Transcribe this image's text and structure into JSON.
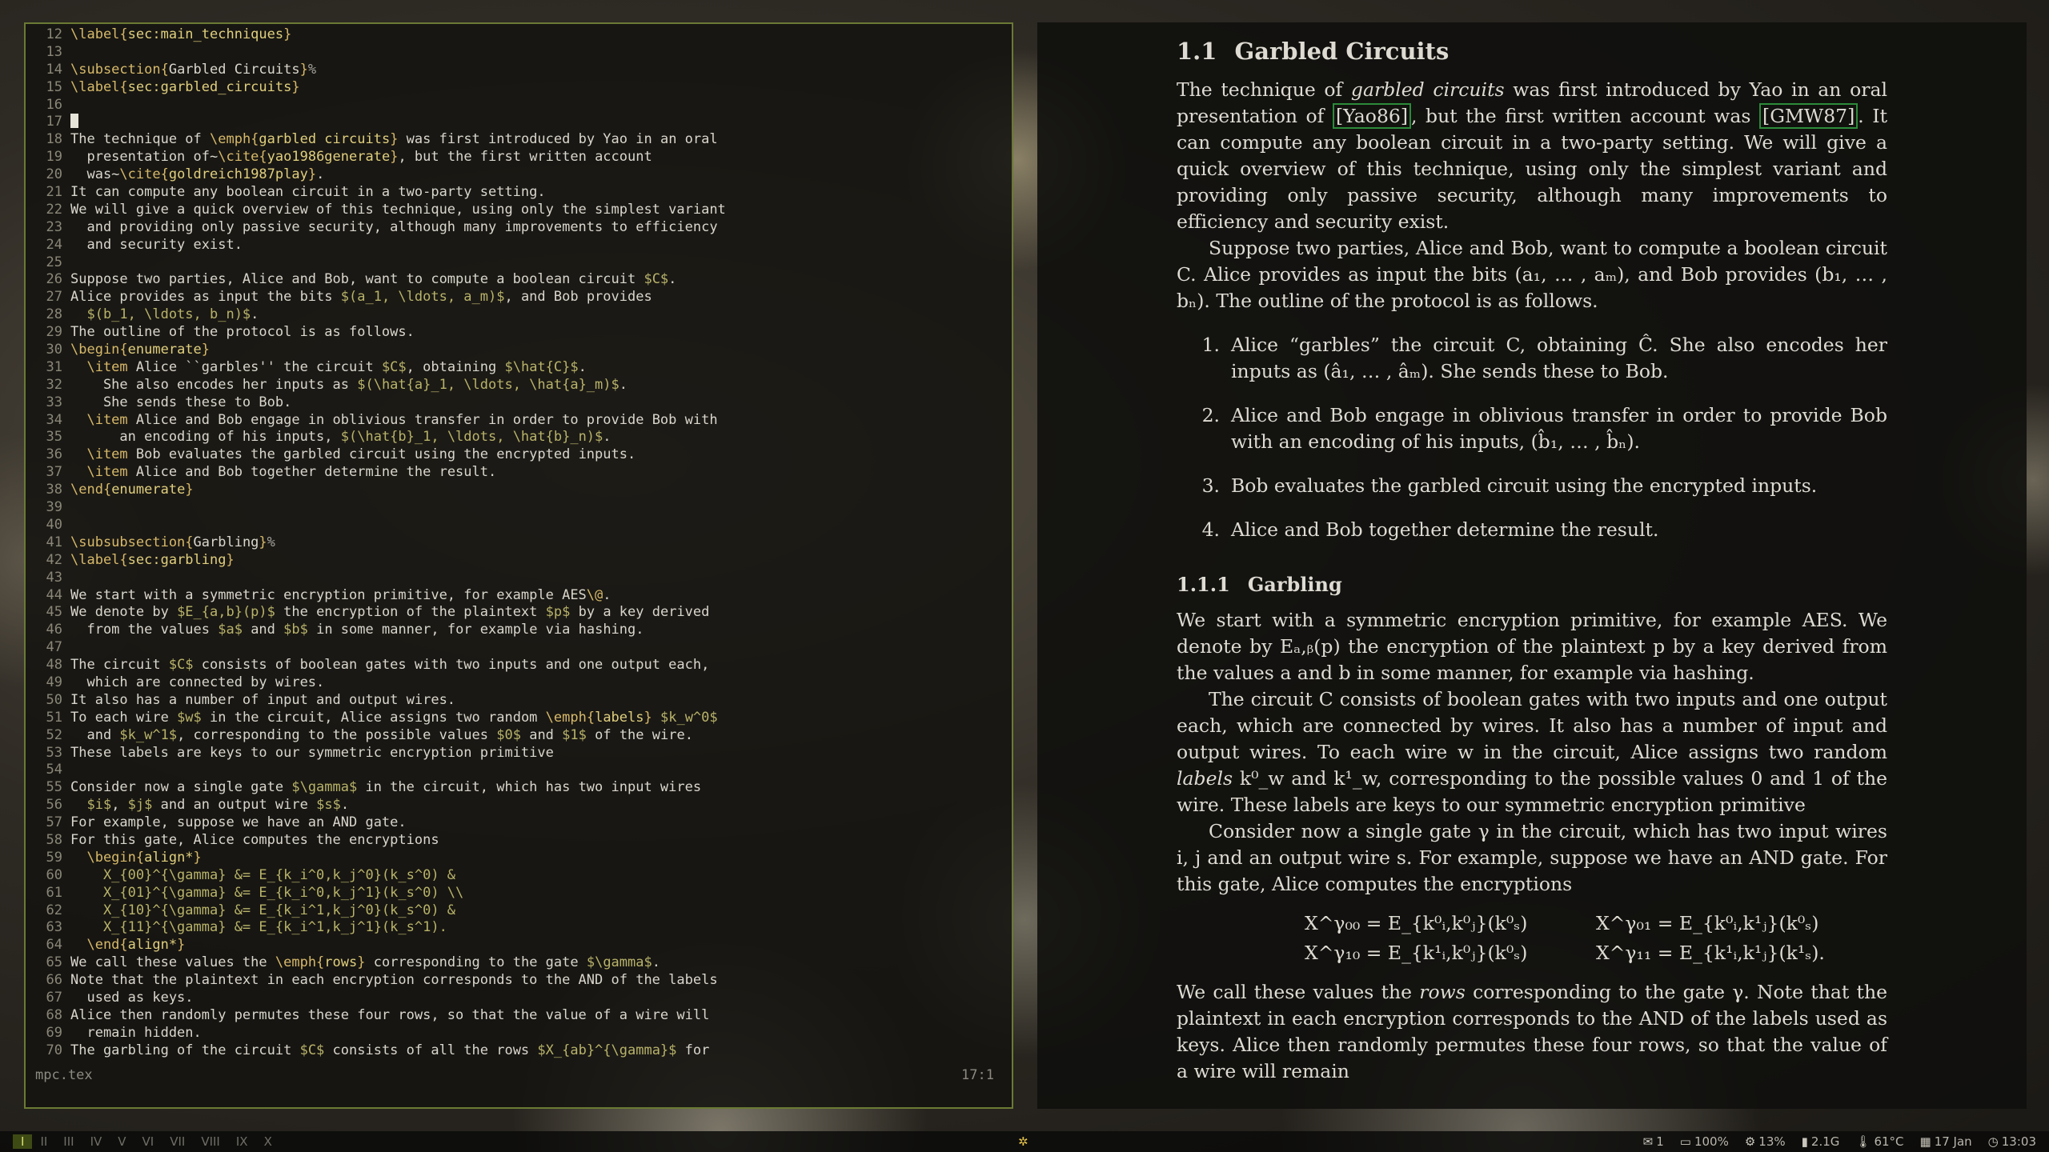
{
  "editor": {
    "filename": "mpc.tex",
    "position": "17:1",
    "lines": [
      {
        "n": "12",
        "segs": [
          [
            "kw",
            "\\label{"
          ],
          [
            "arg",
            "sec:main_techniques"
          ],
          [
            "kw",
            "}"
          ]
        ]
      },
      {
        "n": "13",
        "segs": []
      },
      {
        "n": "14",
        "segs": [
          [
            "kw",
            "\\subsection{"
          ],
          [
            "",
            "Garbled Circuits"
          ],
          [
            "kw",
            "}"
          ],
          [
            "mt",
            "%"
          ]
        ]
      },
      {
        "n": "15",
        "segs": [
          [
            "kw",
            "\\label{"
          ],
          [
            "arg",
            "sec:garbled_circuits"
          ],
          [
            "kw",
            "}"
          ]
        ]
      },
      {
        "n": "16",
        "segs": []
      },
      {
        "n": "17",
        "cursor": true,
        "segs": []
      },
      {
        "n": "18",
        "segs": [
          [
            "",
            "The technique of "
          ],
          [
            "kw",
            "\\emph{"
          ],
          [
            "arg",
            "garbled circuits"
          ],
          [
            "kw",
            "}"
          ],
          [
            "",
            " was first introduced by Yao in an oral"
          ]
        ]
      },
      {
        "n": "19",
        "segs": [
          [
            "",
            "  presentation of~"
          ],
          [
            "kw",
            "\\cite{"
          ],
          [
            "arg",
            "yao1986generate"
          ],
          [
            "kw",
            "}"
          ],
          [
            "",
            ", but the first written account"
          ]
        ]
      },
      {
        "n": "20",
        "segs": [
          [
            "",
            "  was~"
          ],
          [
            "kw",
            "\\cite{"
          ],
          [
            "arg",
            "goldreich1987play"
          ],
          [
            "kw",
            "}"
          ],
          [
            "",
            "."
          ]
        ]
      },
      {
        "n": "21",
        "segs": [
          [
            "",
            "It can compute any boolean circuit in a two-party setting."
          ]
        ]
      },
      {
        "n": "22",
        "segs": [
          [
            "",
            "We will give a quick overview of this technique, using only the simplest variant"
          ]
        ]
      },
      {
        "n": "23",
        "segs": [
          [
            "",
            "  and providing only passive security, although many improvements to efficiency"
          ]
        ]
      },
      {
        "n": "24",
        "segs": [
          [
            "",
            "  and security exist."
          ]
        ]
      },
      {
        "n": "25",
        "segs": []
      },
      {
        "n": "26",
        "segs": [
          [
            "",
            "Suppose two parties, Alice and Bob, want to compute a boolean circuit "
          ],
          [
            "math",
            "$C$"
          ],
          [
            "",
            "."
          ]
        ]
      },
      {
        "n": "27",
        "segs": [
          [
            "",
            "Alice provides as input the bits "
          ],
          [
            "math",
            "$(a_1, \\ldots, a_m)$"
          ],
          [
            "",
            ", and Bob provides"
          ]
        ]
      },
      {
        "n": "28",
        "segs": [
          [
            "math",
            "  $(b_1, \\ldots, b_n)$"
          ],
          [
            "",
            "."
          ]
        ]
      },
      {
        "n": "29",
        "segs": [
          [
            "",
            "The outline of the protocol is as follows."
          ]
        ]
      },
      {
        "n": "30",
        "segs": [
          [
            "kw",
            "\\begin{"
          ],
          [
            "arg",
            "enumerate"
          ],
          [
            "kw",
            "}"
          ]
        ]
      },
      {
        "n": "31",
        "segs": [
          [
            "kw",
            "  \\item"
          ],
          [
            "",
            " Alice ``garbles'' the circuit "
          ],
          [
            "math",
            "$C$"
          ],
          [
            "",
            ", obtaining "
          ],
          [
            "math",
            "$\\hat{C}$"
          ],
          [
            "",
            "."
          ]
        ]
      },
      {
        "n": "32",
        "segs": [
          [
            "",
            "    She also encodes her inputs as "
          ],
          [
            "math",
            "$(\\hat{a}_1, \\ldots, \\hat{a}_m)$"
          ],
          [
            "",
            "."
          ]
        ]
      },
      {
        "n": "33",
        "segs": [
          [
            "",
            "    She sends these to Bob."
          ]
        ]
      },
      {
        "n": "34",
        "segs": [
          [
            "kw",
            "  \\item"
          ],
          [
            "",
            " Alice and Bob engage in oblivious transfer in order to provide Bob with"
          ]
        ]
      },
      {
        "n": "35",
        "segs": [
          [
            "",
            "      an encoding of his inputs, "
          ],
          [
            "math",
            "$(\\hat{b}_1, \\ldots, \\hat{b}_n)$"
          ],
          [
            "",
            "."
          ]
        ]
      },
      {
        "n": "36",
        "segs": [
          [
            "kw",
            "  \\item"
          ],
          [
            "",
            " Bob evaluates the garbled circuit using the encrypted inputs."
          ]
        ]
      },
      {
        "n": "37",
        "segs": [
          [
            "kw",
            "  \\item"
          ],
          [
            "",
            " Alice and Bob together determine the result."
          ]
        ]
      },
      {
        "n": "38",
        "segs": [
          [
            "kw",
            "\\end{"
          ],
          [
            "arg",
            "enumerate"
          ],
          [
            "kw",
            "}"
          ]
        ]
      },
      {
        "n": "39",
        "segs": []
      },
      {
        "n": "40",
        "segs": []
      },
      {
        "n": "41",
        "segs": [
          [
            "kw",
            "\\subsubsection{"
          ],
          [
            "",
            "Garbling"
          ],
          [
            "kw",
            "}"
          ],
          [
            "mt",
            "%"
          ]
        ]
      },
      {
        "n": "42",
        "segs": [
          [
            "kw",
            "\\label{"
          ],
          [
            "arg",
            "sec:garbling"
          ],
          [
            "kw",
            "}"
          ]
        ]
      },
      {
        "n": "43",
        "segs": []
      },
      {
        "n": "44",
        "segs": [
          [
            "",
            "We start with a symmetric encryption primitive, for example AES"
          ],
          [
            "kw",
            "\\@"
          ],
          [
            "",
            "."
          ]
        ]
      },
      {
        "n": "45",
        "segs": [
          [
            "",
            "We denote by "
          ],
          [
            "math",
            "$E_{a,b}(p)$"
          ],
          [
            "",
            " the encryption of the plaintext "
          ],
          [
            "math",
            "$p$"
          ],
          [
            "",
            " by a key derived"
          ]
        ]
      },
      {
        "n": "46",
        "segs": [
          [
            "",
            "  from the values "
          ],
          [
            "math",
            "$a$"
          ],
          [
            "",
            " and "
          ],
          [
            "math",
            "$b$"
          ],
          [
            "",
            " in some manner, for example via hashing."
          ]
        ]
      },
      {
        "n": "47",
        "segs": []
      },
      {
        "n": "48",
        "segs": [
          [
            "",
            "The circuit "
          ],
          [
            "math",
            "$C$"
          ],
          [
            "",
            " consists of boolean gates with two inputs and one output each,"
          ]
        ]
      },
      {
        "n": "49",
        "segs": [
          [
            "",
            "  which are connected by wires."
          ]
        ]
      },
      {
        "n": "50",
        "segs": [
          [
            "",
            "It also has a number of input and output wires."
          ]
        ]
      },
      {
        "n": "51",
        "segs": [
          [
            "",
            "To each wire "
          ],
          [
            "math",
            "$w$"
          ],
          [
            "",
            " in the circuit, Alice assigns two random "
          ],
          [
            "kw",
            "\\emph{"
          ],
          [
            "arg",
            "labels"
          ],
          [
            "kw",
            "}"
          ],
          [
            "math",
            " $k_w^0$"
          ]
        ]
      },
      {
        "n": "52",
        "segs": [
          [
            "",
            "  and "
          ],
          [
            "math",
            "$k_w^1$"
          ],
          [
            "",
            ", corresponding to the possible values "
          ],
          [
            "math",
            "$0$"
          ],
          [
            "",
            " and "
          ],
          [
            "math",
            "$1$"
          ],
          [
            "",
            " of the wire."
          ]
        ]
      },
      {
        "n": "53",
        "segs": [
          [
            "",
            "These labels are keys to our symmetric encryption primitive"
          ]
        ]
      },
      {
        "n": "54",
        "segs": []
      },
      {
        "n": "55",
        "segs": [
          [
            "",
            "Consider now a single gate "
          ],
          [
            "math",
            "$\\gamma$"
          ],
          [
            "",
            " in the circuit, which has two input wires"
          ]
        ]
      },
      {
        "n": "56",
        "segs": [
          [
            "math",
            "  $i$"
          ],
          [
            "",
            ", "
          ],
          [
            "math",
            "$j$"
          ],
          [
            "",
            " and an output wire "
          ],
          [
            "math",
            "$s$"
          ],
          [
            "",
            "."
          ]
        ]
      },
      {
        "n": "57",
        "segs": [
          [
            "",
            "For example, suppose we have an AND gate."
          ]
        ]
      },
      {
        "n": "58",
        "segs": [
          [
            "",
            "For this gate, Alice computes the encryptions"
          ]
        ]
      },
      {
        "n": "59",
        "segs": [
          [
            "kw",
            "  \\begin{"
          ],
          [
            "arg",
            "align*"
          ],
          [
            "kw",
            "}"
          ]
        ]
      },
      {
        "n": "60",
        "segs": [
          [
            "math",
            "    X_{00}^{\\gamma} &= E_{k_i^0,k_j^0}(k_s^0) &"
          ]
        ]
      },
      {
        "n": "61",
        "segs": [
          [
            "math",
            "    X_{01}^{\\gamma} &= E_{k_i^0,k_j^1}(k_s^0) \\\\"
          ]
        ]
      },
      {
        "n": "62",
        "segs": [
          [
            "math",
            "    X_{10}^{\\gamma} &= E_{k_i^1,k_j^0}(k_s^0) &"
          ]
        ]
      },
      {
        "n": "63",
        "segs": [
          [
            "math",
            "    X_{11}^{\\gamma} &= E_{k_i^1,k_j^1}(k_s^1)."
          ]
        ]
      },
      {
        "n": "64",
        "segs": [
          [
            "kw",
            "  \\end{"
          ],
          [
            "arg",
            "align*"
          ],
          [
            "kw",
            "}"
          ]
        ]
      },
      {
        "n": "65",
        "segs": [
          [
            "",
            "We call these values the "
          ],
          [
            "kw",
            "\\emph{"
          ],
          [
            "arg",
            "rows"
          ],
          [
            "kw",
            "}"
          ],
          [
            "",
            " corresponding to the gate "
          ],
          [
            "math",
            "$\\gamma$"
          ],
          [
            "",
            "."
          ]
        ]
      },
      {
        "n": "66",
        "segs": [
          [
            "",
            "Note that the plaintext in each encryption corresponds to the AND of the labels"
          ]
        ]
      },
      {
        "n": "67",
        "segs": [
          [
            "",
            "  used as keys."
          ]
        ]
      },
      {
        "n": "68",
        "segs": [
          [
            "",
            "Alice then randomly permutes these four rows, so that the value of a wire will"
          ]
        ]
      },
      {
        "n": "69",
        "segs": [
          [
            "",
            "  remain hidden."
          ]
        ]
      },
      {
        "n": "70",
        "segs": [
          [
            "",
            "The garbling of the circuit "
          ],
          [
            "math",
            "$C$"
          ],
          [
            "",
            " consists of all the rows "
          ],
          [
            "math",
            "$X_{ab}^{\\gamma}$"
          ],
          [
            "",
            " for"
          ]
        ]
      }
    ]
  },
  "viewer": {
    "section_number": "1.1",
    "section_title": "Garbled Circuits",
    "subsection_number": "1.1.1",
    "subsection_title": "Garbling",
    "cite_yao": "[Yao86]",
    "cite_gmw": "[GMW87]",
    "p1_a": "The technique of ",
    "p1_em": "garbled circuits",
    "p1_b": " was first introduced by Yao in an oral presentation of ",
    "p1_c": ", but the first written account was ",
    "p1_d": ". It can compute any boolean circuit in a two-party setting. We will give a quick overview of this technique, using only the simplest variant and providing only passive security, although many improvements to efficiency and security exist.",
    "p2": "Suppose two parties, Alice and Bob, want to compute a boolean circuit C. Alice provides as input the bits (a₁, … , aₘ), and Bob provides (b₁, … , bₙ). The outline of the protocol is as follows.",
    "items": [
      {
        "num": "1.",
        "text": "Alice “garbles” the circuit C, obtaining Ĉ. She also encodes her inputs as (â₁, … , âₘ). She sends these to Bob."
      },
      {
        "num": "2.",
        "text": "Alice and Bob engage in oblivious transfer in order to provide Bob with an encoding of his inputs, (b̂₁, … , b̂ₙ)."
      },
      {
        "num": "3.",
        "text": "Bob evaluates the garbled circuit using the encrypted inputs."
      },
      {
        "num": "4.",
        "text": "Alice and Bob together determine the result."
      }
    ],
    "p3": "We start with a symmetric encryption primitive, for example AES. We denote by Eₐ,ᵦ(p) the encryption of the plaintext p by a key derived from the values a and b in some manner, for example via hashing.",
    "p4_a": "The circuit C consists of boolean gates with two inputs and one output each, which are connected by wires. It also has a number of input and output wires. To each wire w in the circuit, Alice assigns two random ",
    "p4_em": "labels",
    "p4_b": " k⁰_w and k¹_w, corresponding to the possible values 0 and 1 of the wire. These labels are keys to our symmetric encryption primitive",
    "p5": "Consider now a single gate γ in the circuit, which has two input wires i, j and an output wire s. For example, suppose we have an AND gate. For this gate, Alice computes the encryptions",
    "eq": [
      "X^γ₀₀ = E_{k⁰ᵢ,k⁰ⱼ}(k⁰ₛ)",
      "X^γ₀₁ = E_{k⁰ᵢ,k¹ⱼ}(k⁰ₛ)",
      "X^γ₁₀ = E_{k¹ᵢ,k⁰ⱼ}(k⁰ₛ)",
      "X^γ₁₁ = E_{k¹ᵢ,k¹ⱼ}(k¹ₛ)."
    ],
    "p6_a": "We call these values the ",
    "p6_em": "rows",
    "p6_b": " corresponding to the gate γ. Note that the plaintext in each encryption corresponds to the AND of the labels used as keys. Alice then randomly permutes these four rows, so that the value of a wire will remain"
  },
  "taskbar": {
    "workspaces": [
      "I",
      "II",
      "III",
      "IV",
      "V",
      "VI",
      "VII",
      "VIII",
      "IX",
      "X"
    ],
    "active_workspace": "I",
    "mail": "1",
    "battery": "100%",
    "cpu": "13%",
    "mem": "2.1G",
    "temp": "61°C",
    "date": "17 Jan",
    "time": "13:03"
  },
  "colors": {
    "accent": "#6b7a34",
    "cite_box": "#2c8a3a",
    "latex_keyword": "#d7b96a",
    "latex_math": "#b8b36a"
  }
}
